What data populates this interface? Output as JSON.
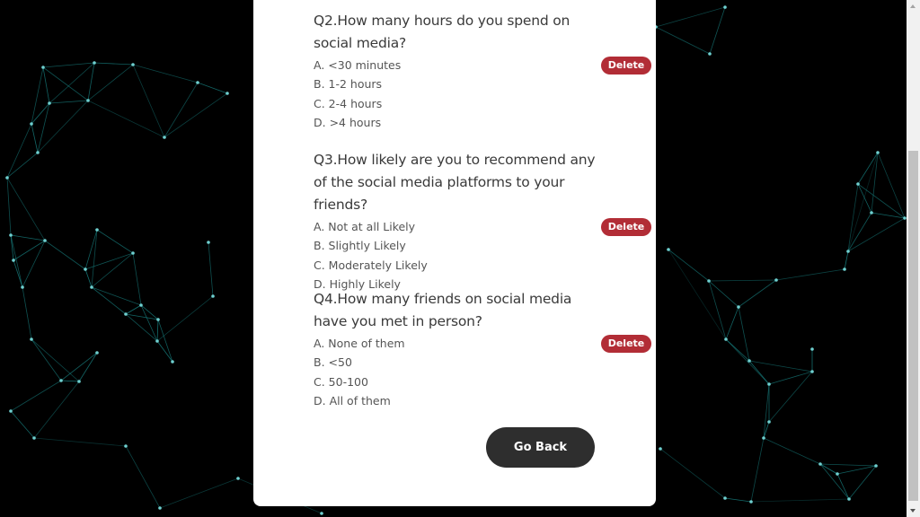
{
  "questions": [
    {
      "title": "Q2.How many hours do you spend on social media?",
      "options": [
        "A. <30 minutes",
        "B. 1-2 hours",
        "C. 2-4 hours",
        "D. >4 hours"
      ],
      "delete_label": "Delete"
    },
    {
      "title": "Q3.How likely are you to recommend any of the social media platforms to your friends?",
      "options": [
        "A. Not at all Likely",
        "B. Slightly Likely",
        "C. Moderately Likely",
        "D. Highly Likely"
      ],
      "delete_label": "Delete"
    },
    {
      "title": "Q4.How many friends on social media have you met in person?",
      "options": [
        "A. None of them",
        "B. <50",
        "C. 50-100",
        "D. All of them"
      ],
      "delete_label": "Delete"
    }
  ],
  "go_back_label": "Go Back",
  "colors": {
    "background": "#000000",
    "network": "#1a8f8f",
    "delete": "#b22d36",
    "go_back": "#2e2e2e"
  }
}
